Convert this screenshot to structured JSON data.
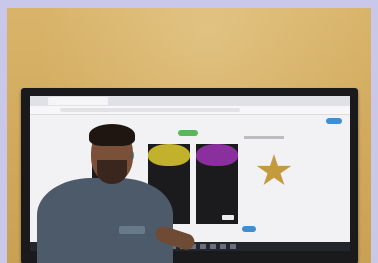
{
  "scene": {
    "description_visible_text": [],
    "screen": {
      "cards": [
        {
          "color": "#1fa7c9"
        },
        {
          "color": "#c2b12b"
        },
        {
          "color": "#8c2f9e"
        }
      ],
      "accent_blue": "#3a8fd6",
      "accent_green": "#58b85a",
      "star_color": "#c49a3e"
    }
  }
}
